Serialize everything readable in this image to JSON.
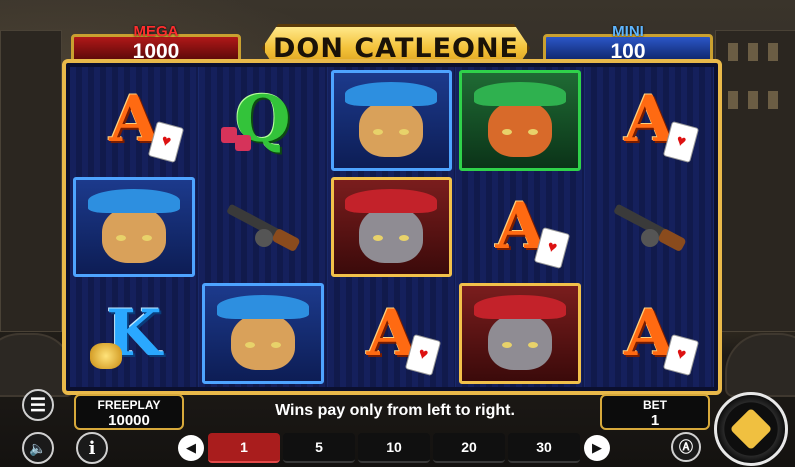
{
  "game": {
    "title": "DON CATLEONE"
  },
  "jackpots": {
    "mega": {
      "label": "MEGA",
      "value": "1000",
      "color": "#ff2d2d"
    },
    "mini": {
      "label": "MINI",
      "value": "100",
      "color": "#5fb6ff"
    }
  },
  "reels": {
    "columns": [
      [
        "A",
        "blue-hat-cat",
        "K"
      ],
      [
        "Q",
        "tommy-gun",
        "blue-hat-cat"
      ],
      [
        "blue-hat-cat",
        "red-hat-cat",
        "A"
      ],
      [
        "green-hat-cat",
        "A",
        "red-hat-cat"
      ],
      [
        "A",
        "tommy-gun",
        "A"
      ]
    ]
  },
  "freeplay": {
    "label": "FREEPLAY",
    "value": "10000"
  },
  "message": "Wins pay only from left to right.",
  "bet": {
    "label": "BET",
    "value": "1"
  },
  "bet_options": [
    "1",
    "5",
    "10",
    "20",
    "30"
  ],
  "selected_bet": "1",
  "icons": {
    "menu": "hamburger-menu-icon",
    "sound": "speaker-icon",
    "info": "info-icon",
    "prev": "arrow-left-icon",
    "next": "arrow-right-icon",
    "autoplay": "autoplay-icon",
    "spin": "spin-icon"
  },
  "colors": {
    "gold_frame": "#e9b94a",
    "selected_bet": "#a91d1d"
  }
}
